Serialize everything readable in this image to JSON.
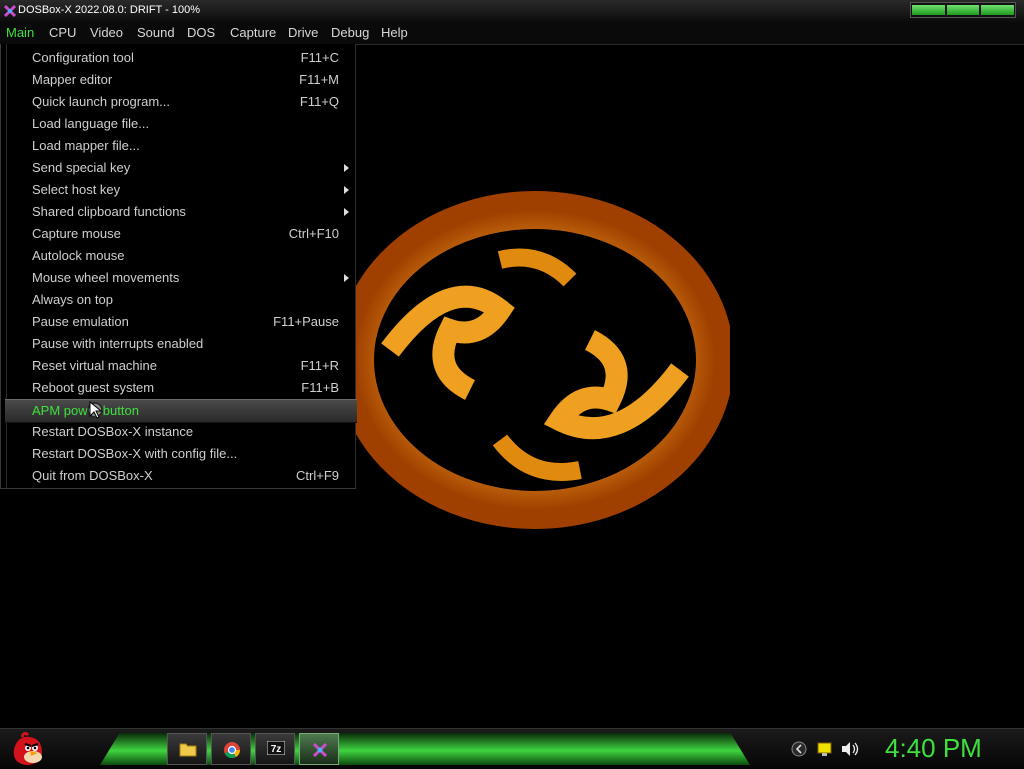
{
  "window": {
    "title": "DOSBox-X 2022.08.0: DRIFT - 100%",
    "controls": [
      "minimize-button",
      "maximize-button",
      "close-button"
    ]
  },
  "menubar": {
    "items": [
      "Main",
      "CPU",
      "Video",
      "Sound",
      "DOS",
      "Capture",
      "Drive",
      "Debug",
      "Help"
    ],
    "active": "Main",
    "active_color": "#3ee03e"
  },
  "main_menu": {
    "items": [
      {
        "label": "Configuration tool",
        "shortcut": "F11+C"
      },
      {
        "label": "Mapper editor",
        "shortcut": "F11+M"
      },
      {
        "label": "Quick launch program...",
        "shortcut": "F11+Q"
      },
      {
        "label": "Load language file...",
        "shortcut": ""
      },
      {
        "label": "Load mapper file...",
        "shortcut": ""
      },
      {
        "label": "Send special key",
        "shortcut": "",
        "submenu": true
      },
      {
        "label": "Select host key",
        "shortcut": "",
        "submenu": true
      },
      {
        "label": "Shared clipboard functions",
        "shortcut": "",
        "submenu": true
      },
      {
        "label": "Capture mouse",
        "shortcut": "Ctrl+F10"
      },
      {
        "label": "Autolock mouse",
        "shortcut": ""
      },
      {
        "label": "Mouse wheel movements",
        "shortcut": "",
        "submenu": true
      },
      {
        "label": "Always on top",
        "shortcut": ""
      },
      {
        "label": "Pause emulation",
        "shortcut": "F11+Pause"
      },
      {
        "label": "Pause with interrupts enabled",
        "shortcut": ""
      },
      {
        "label": "Reset virtual machine",
        "shortcut": "F11+R"
      },
      {
        "label": "Reboot guest system",
        "shortcut": "F11+B"
      },
      {
        "label": "APM power button",
        "shortcut": "",
        "highlighted": true
      },
      {
        "label": "Restart DOSBox-X instance",
        "shortcut": ""
      },
      {
        "label": "Restart DOSBox-X with config file...",
        "shortcut": ""
      },
      {
        "label": "Quit from DOSBox-X",
        "shortcut": "Ctrl+F9"
      }
    ]
  },
  "taskbar": {
    "start_icon": "angry-bird-icon",
    "buttons": [
      {
        "name": "folder-icon",
        "active": false
      },
      {
        "name": "chrome-icon",
        "active": false
      },
      {
        "name": "7zip-icon",
        "label": "7z",
        "active": false
      },
      {
        "name": "dosbox-icon",
        "active": true
      }
    ],
    "tray_icons": [
      "chevron-left-icon",
      "notification-icon",
      "volume-icon"
    ],
    "clock": "4:40 PM",
    "clock_color": "#3ee03e"
  }
}
